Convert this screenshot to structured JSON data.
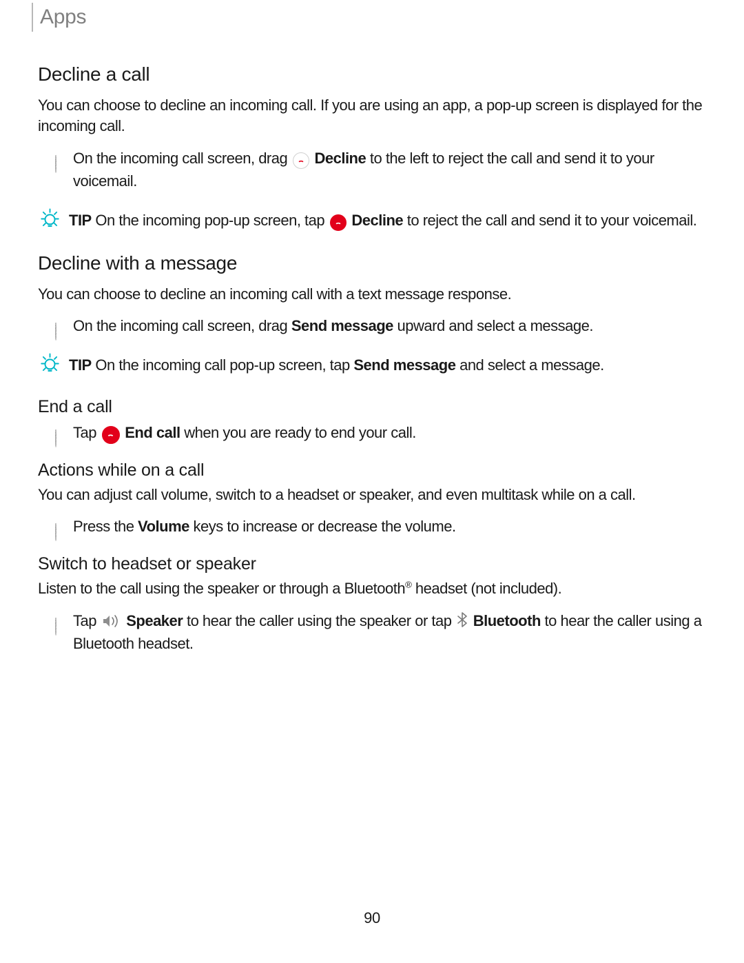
{
  "header": {
    "title": "Apps"
  },
  "labels": {
    "tip": "TIP",
    "decline": "Decline",
    "send_message": "Send message",
    "end_call": "End call",
    "volume": "Volume",
    "speaker": "Speaker",
    "bluetooth": "Bluetooth"
  },
  "sec1": {
    "title": "Decline a call",
    "intro": "You can choose to decline an incoming call. If you are using an app, a pop-up screen is displayed for the incoming call.",
    "bullet_pre": "On the incoming call screen, drag ",
    "bullet_post": " to the left to reject the call and send it to your voicemail.",
    "tip_pre": " On the incoming pop-up screen, tap ",
    "tip_post": " to reject the call and send it to your voicemail."
  },
  "sec2": {
    "title": "Decline with a message",
    "intro": "You can choose to decline an incoming call with a text message response.",
    "bullet_pre": "On the incoming call screen, drag ",
    "bullet_post": " upward and select a message.",
    "tip_pre": " On the incoming call pop-up screen, tap ",
    "tip_post": " and select a message."
  },
  "sec3": {
    "title": "End a call",
    "bullet_pre": "Tap ",
    "bullet_post": " when you are ready to end your call."
  },
  "sec4": {
    "title": "Actions while on a call",
    "intro": "You can adjust call volume, switch to a headset or speaker, and even multitask while on a call.",
    "bullet_pre": "Press the ",
    "bullet_post": " keys to increase or decrease the volume."
  },
  "sec5": {
    "title": "Switch to headset or speaker",
    "intro_pre": "Listen to the call using the speaker or through a Bluetooth",
    "intro_post": " headset (not included).",
    "bullet_pre": "Tap ",
    "bullet_mid1": " to hear the caller using the speaker or tap ",
    "bullet_post": " to hear the caller using a Bluetooth headset."
  },
  "page_number": "90"
}
